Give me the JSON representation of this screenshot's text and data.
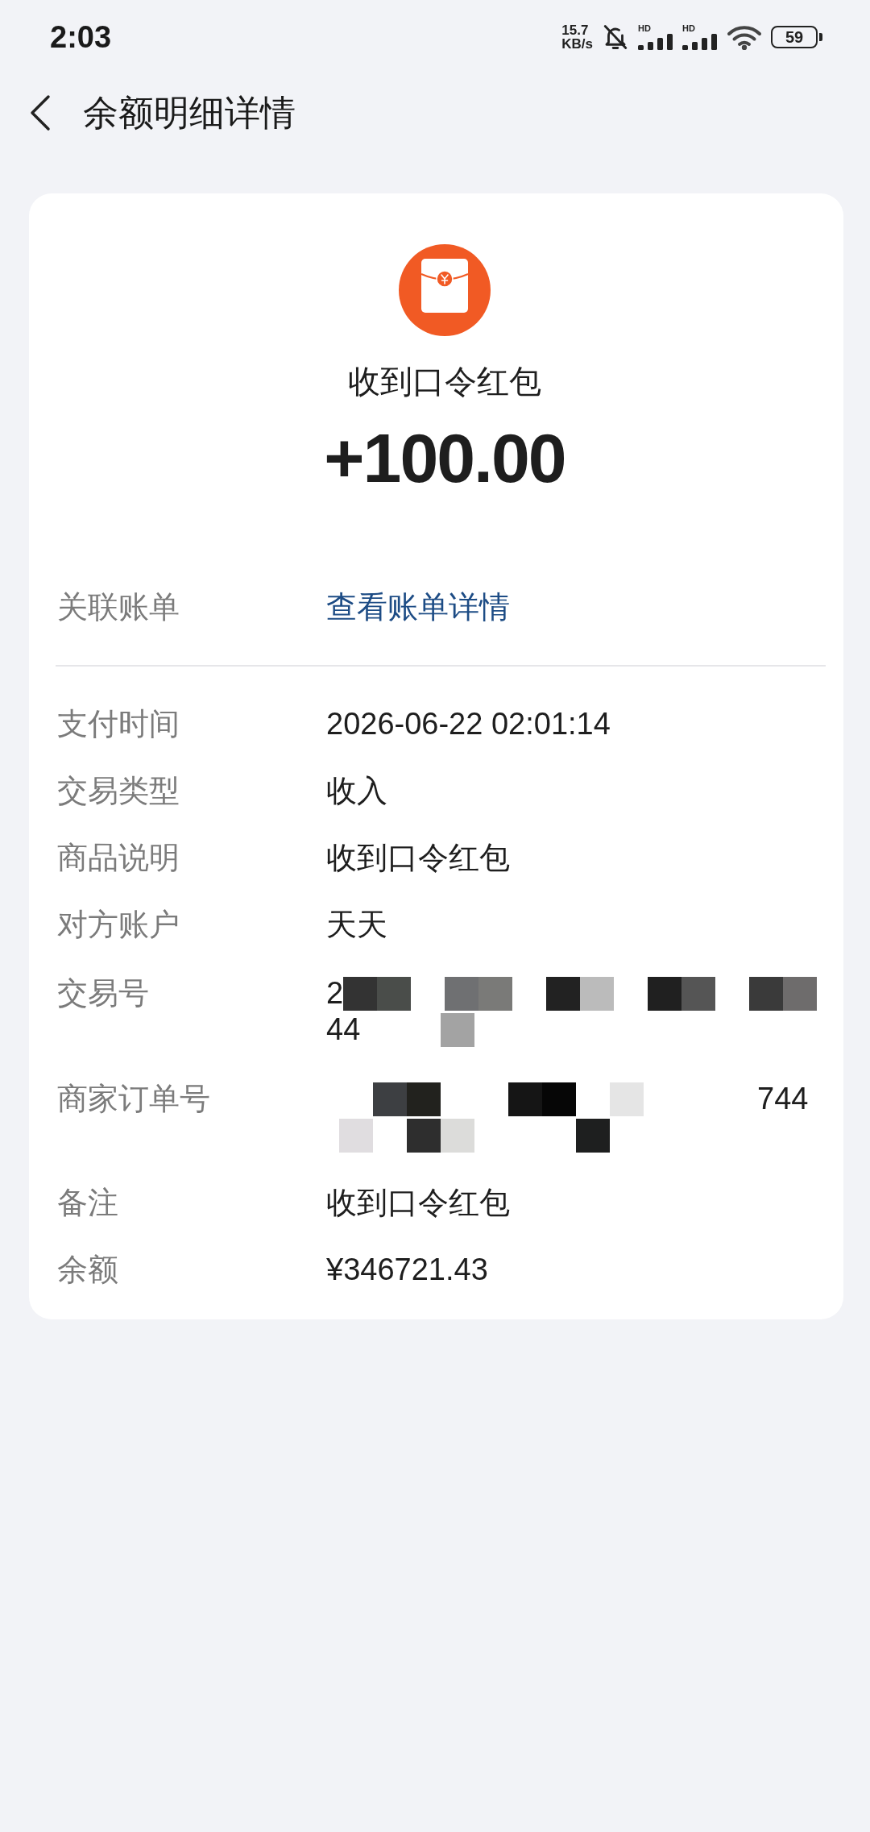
{
  "status_bar": {
    "time": "2:03",
    "net_speed": "15.7",
    "net_speed_unit": "KB/s",
    "signals": [
      {
        "label": "HD"
      },
      {
        "label": "HD"
      }
    ],
    "battery": "59"
  },
  "header": {
    "title": "余额明细详情"
  },
  "summary": {
    "title": "收到口令红包",
    "amount": "+100.00"
  },
  "linked_bill": {
    "label": "关联账单",
    "link": "查看账单详情"
  },
  "details": [
    {
      "kind": "text",
      "label": "支付时间",
      "value": "2026-06-22 02:01:14"
    },
    {
      "kind": "text",
      "label": "交易类型",
      "value": "收入"
    },
    {
      "kind": "text",
      "label": "商品说明",
      "value": "收到口令红包"
    },
    {
      "kind": "text",
      "label": "对方账户",
      "value": "天天"
    },
    {
      "kind": "redacted",
      "label": "交易号",
      "lines": [
        {
          "segments": [
            {
              "kind": "text",
              "text": "2"
            },
            {
              "kind": "mosaic"
            }
          ]
        },
        {
          "segments": [
            {
              "kind": "text",
              "text": "44"
            },
            {
              "kind": "mosaic"
            }
          ]
        }
      ]
    },
    {
      "kind": "redacted",
      "label": "商家订单号",
      "lines": [
        {
          "segments": [
            {
              "kind": "mosaic"
            },
            {
              "kind": "text",
              "text": "744"
            }
          ]
        },
        {
          "segments": [
            {
              "kind": "mosaic"
            }
          ]
        }
      ]
    },
    {
      "kind": "text",
      "label": "备注",
      "value": "收到口令红包"
    },
    {
      "kind": "text",
      "label": "余额",
      "value": "¥346721.43"
    }
  ]
}
